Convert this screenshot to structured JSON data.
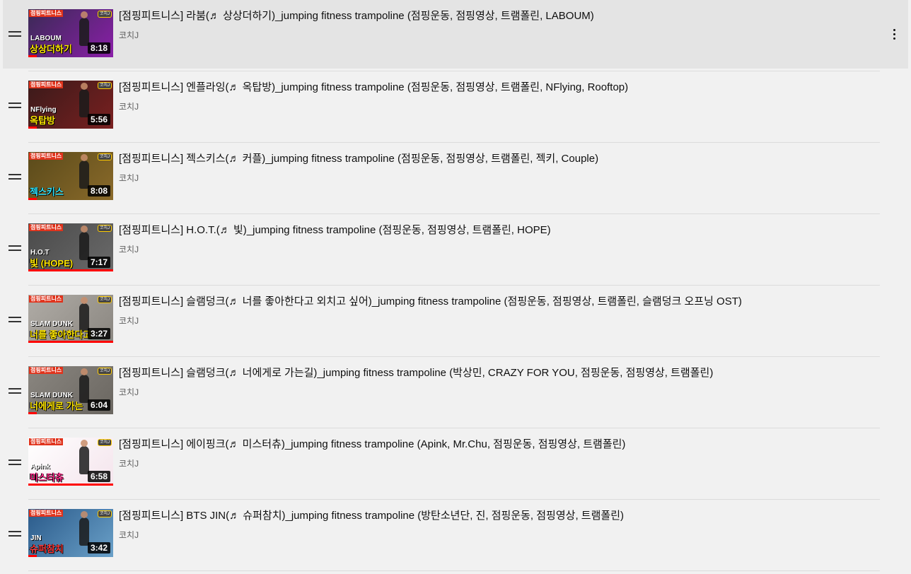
{
  "playlist": {
    "more_actions_icon": "vertical-ellipsis-icon",
    "drag_icon": "drag-handle-icon",
    "accent_progress_color": "#ff0000",
    "items": [
      {
        "title": "[점핑피트니스] 라붐(♬ 상상더하기)_jumping fitness trampoline (점핑운동, 점핑영상, 트램폴린, LABOUM)",
        "channel": "코치J",
        "duration": "8:18",
        "watched_fraction": 0.1,
        "thumb_tag": "점핑피트니스",
        "thumb_badge": "코치J",
        "thumb_sub": "LABOUM",
        "thumb_main": "상상더하기",
        "thumb_colors": [
          "#3a2a55",
          "#8a1fa8"
        ],
        "thumb_text_color": "#ffe600",
        "active": true
      },
      {
        "title": "[점핑피트니스] 엔플라잉(♬ 옥탑방)_jumping fitness trampoline (점핑운동, 점핑영상, 트램폴린, NFlying, Rooftop)",
        "channel": "코치J",
        "duration": "5:56",
        "watched_fraction": 0.1,
        "thumb_tag": "점핑피트니스",
        "thumb_badge": "코치J",
        "thumb_sub": "NFlying",
        "thumb_main": "옥탑방",
        "thumb_colors": [
          "#3a1a1a",
          "#7a2020"
        ],
        "thumb_text_color": "#ffe600",
        "active": false
      },
      {
        "title": "[점핑피트니스] 젝스키스(♬ 커플)_jumping fitness trampoline (점핑운동, 점핑영상, 트램폴린, 젝키, Couple)",
        "channel": "코치J",
        "duration": "8:08",
        "watched_fraction": 0.1,
        "thumb_tag": "점핑피트니스",
        "thumb_badge": "코치J",
        "thumb_sub": "",
        "thumb_main": "젝스키스",
        "thumb_colors": [
          "#5a4a1a",
          "#8a6a2a"
        ],
        "thumb_text_color": "#2ee6ff",
        "active": false
      },
      {
        "title": "[점핑피트니스] H.O.T.(♬ 빛)_jumping fitness trampoline (점핑운동, 점핑영상, 트램폴린, HOPE)",
        "channel": "코치J",
        "duration": "7:17",
        "watched_fraction": 1.0,
        "thumb_tag": "점핑피트니스",
        "thumb_badge": "코치J",
        "thumb_sub": "H.O.T",
        "thumb_main": "빛 (HOPE)",
        "thumb_colors": [
          "#4a4a4a",
          "#6a6a6a"
        ],
        "thumb_text_color": "#ffe600",
        "active": false
      },
      {
        "title": "[점핑피트니스] 슬램덩크(♬ 너를 좋아한다고 외치고 싶어)_jumping fitness trampoline (점핑운동, 점핑영상, 트램폴린, 슬램덩크 오프닝 OST)",
        "channel": "코치J",
        "duration": "3:27",
        "watched_fraction": 1.0,
        "thumb_tag": "점핑피트니스",
        "thumb_badge": "코치J",
        "thumb_sub": "SLAM DUNK",
        "thumb_main": "너를 좋아한다고",
        "thumb_colors": [
          "#b0aca6",
          "#8a8680"
        ],
        "thumb_text_color": "#ffe600",
        "active": false
      },
      {
        "title": "[점핑피트니스] 슬램덩크(♬ 너에게로 가는길)_jumping fitness trampoline (박상민, CRAZY FOR YOU, 점핑운동, 점핑영상, 트램폴린)",
        "channel": "코치J",
        "duration": "6:04",
        "watched_fraction": 0.1,
        "thumb_tag": "점핑피트니스",
        "thumb_badge": "코치J",
        "thumb_sub": "SLAM DUNK",
        "thumb_main": "너에게로 가는",
        "thumb_colors": [
          "#8a8680",
          "#6a6660"
        ],
        "thumb_text_color": "#ffe600",
        "active": false
      },
      {
        "title": "[점핑피트니스] 에이핑크(♬ 미스터츄)_jumping fitness trampoline (Apink, Mr.Chu, 점핑운동, 점핑영상, 트램폴린)",
        "channel": "코치J",
        "duration": "6:58",
        "watched_fraction": 1.0,
        "thumb_tag": "점핑피트니스",
        "thumb_badge": "코치J",
        "thumb_sub": "Apink",
        "thumb_main": "미스터츄",
        "thumb_colors": [
          "#ffffff",
          "#f4e4ec"
        ],
        "thumb_text_color": "#ff2a8a",
        "active": false
      },
      {
        "title": "[점핑피트니스] BTS JIN(♬ 슈퍼참치)_jumping fitness trampoline (방탄소년단, 진, 점핑운동, 점핑영상, 트램폴린)",
        "channel": "코치J",
        "duration": "3:42",
        "watched_fraction": 0.1,
        "thumb_tag": "점핑피트니스",
        "thumb_badge": "코치J",
        "thumb_sub": "JIN",
        "thumb_main": "슈퍼참치",
        "thumb_colors": [
          "#2a5a8a",
          "#6aa0c8"
        ],
        "thumb_text_color": "#ff3a3a",
        "active": false
      }
    ]
  }
}
